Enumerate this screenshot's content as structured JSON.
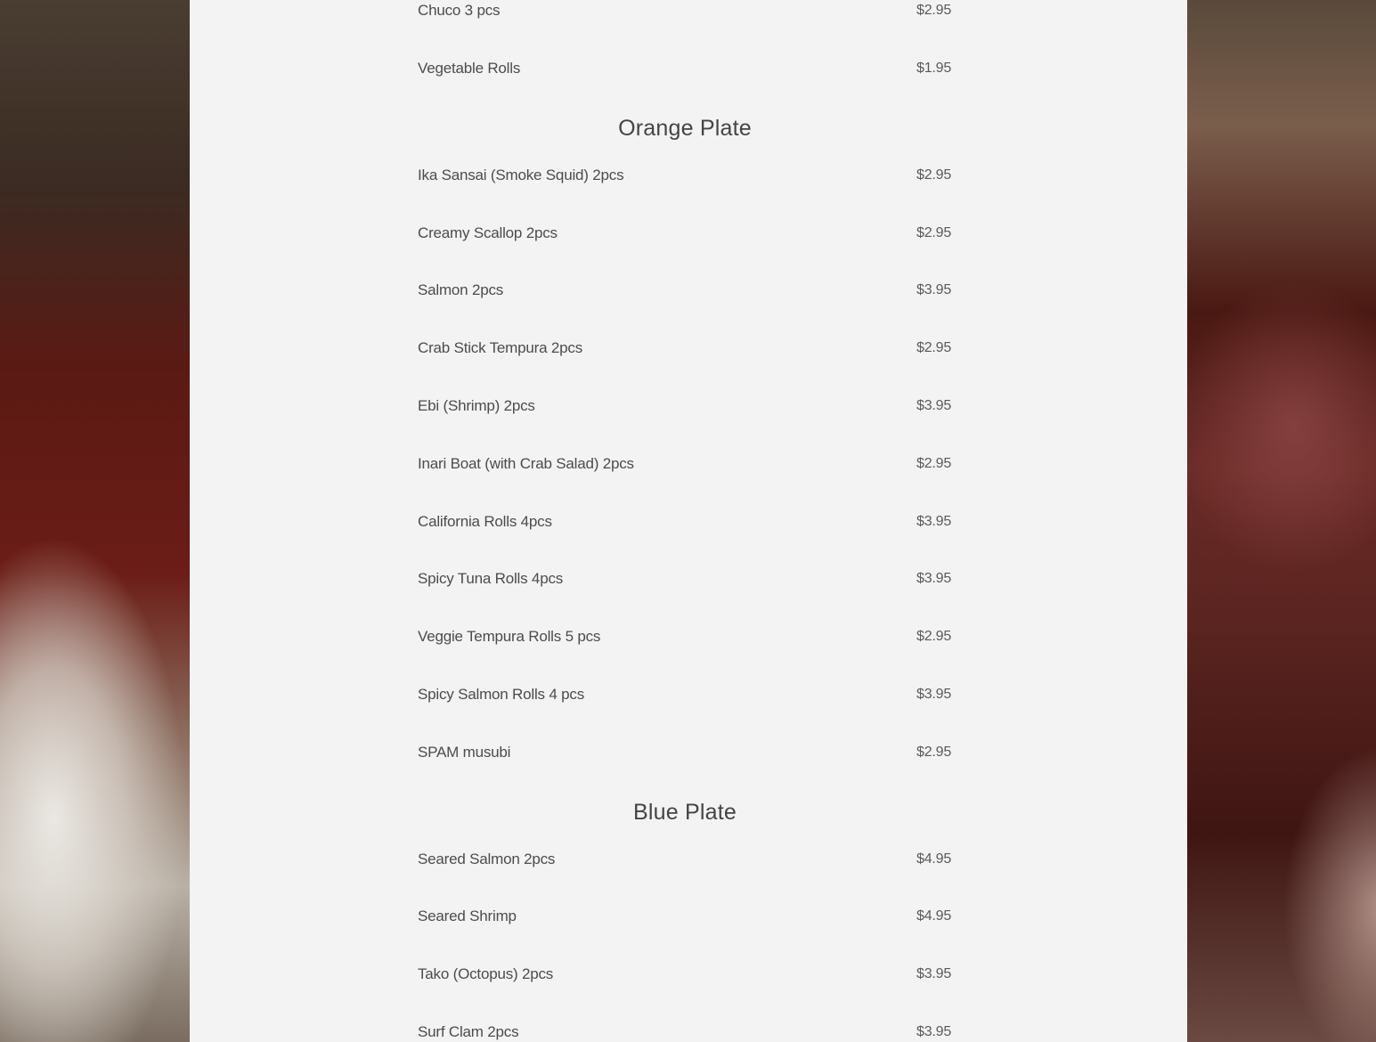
{
  "sections": [
    {
      "title": "",
      "items": [
        {
          "name": "Chuco 3 pcs",
          "price": "$2.95"
        },
        {
          "name": "Vegetable Rolls",
          "price": "$1.95"
        }
      ]
    },
    {
      "title": "Orange Plate",
      "items": [
        {
          "name": "Ika Sansai (Smoke Squid) 2pcs",
          "price": "$2.95"
        },
        {
          "name": "Creamy Scallop 2pcs",
          "price": "$2.95"
        },
        {
          "name": "Salmon 2pcs",
          "price": "$3.95"
        },
        {
          "name": "Crab Stick Tempura 2pcs",
          "price": "$2.95"
        },
        {
          "name": "Ebi (Shrimp) 2pcs",
          "price": "$3.95"
        },
        {
          "name": "Inari Boat (with Crab Salad) 2pcs",
          "price": "$2.95"
        },
        {
          "name": "California Rolls 4pcs",
          "price": "$3.95"
        },
        {
          "name": "Spicy Tuna Rolls 4pcs",
          "price": "$3.95"
        },
        {
          "name": "Veggie Tempura Rolls 5 pcs",
          "price": "$2.95"
        },
        {
          "name": "Spicy Salmon Rolls 4 pcs",
          "price": "$3.95"
        },
        {
          "name": "SPAM musubi",
          "price": "$2.95"
        }
      ]
    },
    {
      "title": "Blue Plate",
      "items": [
        {
          "name": "Seared Salmon 2pcs",
          "price": "$4.95"
        },
        {
          "name": "Seared Shrimp",
          "price": "$4.95"
        },
        {
          "name": "Tako (Octopus) 2pcs",
          "price": "$3.95"
        },
        {
          "name": "Surf Clam 2pcs",
          "price": "$3.95"
        }
      ]
    }
  ]
}
